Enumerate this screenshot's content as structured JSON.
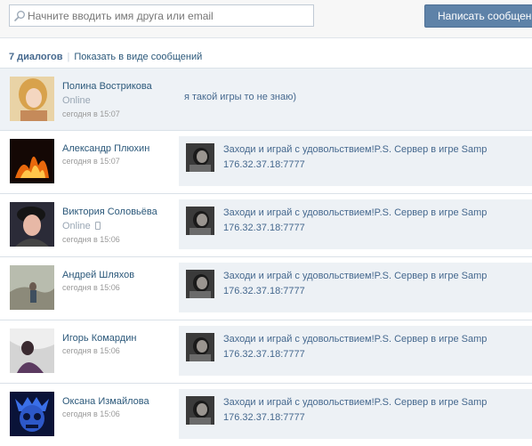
{
  "search": {
    "placeholder": "Начните вводить имя друга или email"
  },
  "toolbar": {
    "write_label": "Написать сообщение"
  },
  "header": {
    "count_label": "7 диалогов",
    "separator": "|",
    "toggle_label": "Показать в виде сообщений"
  },
  "dialogs": [
    {
      "name": "Полина Вострикова",
      "status": "Online",
      "date": "сегодня в 15:07",
      "message": "я такой игры то не знаю)",
      "avatar_colors": [
        "#f2d7a0",
        "#a86a3a"
      ]
    },
    {
      "name": "Александр Плюхин",
      "status": "",
      "date": "сегодня в 15:07",
      "message": "Заходи и играй с удовольствием!P.S. Сервер в игре Samp 176.32.37.18:7777",
      "avatar_colors": [
        "#1a0a05",
        "#f07a10"
      ]
    },
    {
      "name": "Виктория Соловьёва",
      "status": "Online",
      "date": "сегодня в 15:06",
      "message": "Заходи и играй с удовольствием!P.S. Сервер в игре Samp 176.32.37.18:7777",
      "avatar_colors": [
        "#2a2a35",
        "#d08888"
      ]
    },
    {
      "name": "Андрей Шляхов",
      "status": "",
      "date": "сегодня в 15:06",
      "message": "Заходи и играй с удовольствием!P.S. Сервер в игре Samp 176.32.37.18:7777",
      "avatar_colors": [
        "#b9bfb1",
        "#6f6a5a"
      ]
    },
    {
      "name": "Игорь Комардин",
      "status": "",
      "date": "сегодня в 15:06",
      "message": "Заходи и играй с удовольствием!P.S. Сервер в игре Samp 176.32.37.18:7777",
      "avatar_colors": [
        "#cfcfcf",
        "#5b3a60"
      ]
    },
    {
      "name": "Оксана Измайлова",
      "status": "",
      "date": "сегодня в 15:06",
      "message": "Заходи и играй с удовольствием!P.S. Сервер в игре Samp 176.32.37.18:7777",
      "avatar_colors": [
        "#0c1440",
        "#3a6fe8"
      ]
    }
  ],
  "colors": {
    "link": "#2b587a",
    "accent": "#5e82a8",
    "message_bg": "#edf1f5",
    "muted": "#999999"
  }
}
